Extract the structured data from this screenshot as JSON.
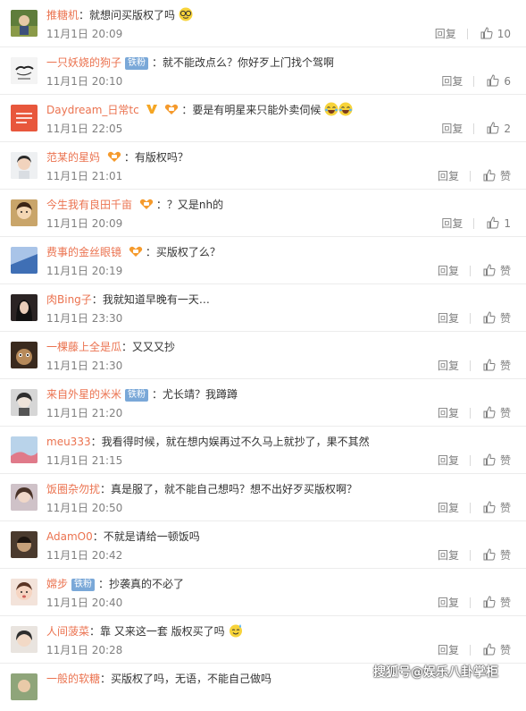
{
  "actions": {
    "reply_label": "回复",
    "like_label": "赞"
  },
  "colors": {
    "username": "#eb7350",
    "meta": "#808080",
    "badge_bg": "#7aa8d8"
  },
  "comments": [
    {
      "user": "推糖机",
      "text": "就想问买版权了吗",
      "emoji": "glasses-emoji",
      "time": "11月1日 20:09",
      "likes": "10",
      "badge": "",
      "fan": false,
      "verified": false
    },
    {
      "user": "一只妖娆的狗子",
      "text": "就不能改点么？你好歹上门找个驾啊",
      "time": "11月1日 20:10",
      "likes": "6",
      "badge": "铁粉",
      "fan": false,
      "verified": false
    },
    {
      "user": "Daydream_日常tc",
      "text": "要是有明星来只能外卖伺候",
      "emoji": "laugh-cry-emoji",
      "time": "11月1日 22:05",
      "likes": "2",
      "badge": "",
      "fan": true,
      "verified": false
    },
    {
      "user": "范某的星妈",
      "text": "有版权吗？",
      "time": "11月1日 21:01",
      "likes": "赞",
      "badge": "",
      "fan": true,
      "verified": false
    },
    {
      "user": "今生我有良田千亩",
      "text": "？又是nh的",
      "time": "11月1日 20:09",
      "likes": "1",
      "badge": "",
      "fan": true,
      "verified": false
    },
    {
      "user": "费事的金丝眼镜",
      "text": "买版权了么？",
      "time": "11月1日 20:19",
      "likes": "赞",
      "badge": "",
      "fan": true,
      "verified": false
    },
    {
      "user": "肉Bing子",
      "text": "我就知道早晚有一天…",
      "time": "11月1日 23:30",
      "likes": "赞",
      "badge": "",
      "fan": false,
      "verified": false
    },
    {
      "user": "一棵藤上全是瓜",
      "text": "又又又抄",
      "time": "11月1日 21:30",
      "likes": "赞",
      "badge": "",
      "fan": false,
      "verified": false
    },
    {
      "user": "来自外星的米米",
      "text": "尤长靖？我蹲蹲",
      "time": "11月1日 21:20",
      "likes": "赞",
      "badge": "铁粉",
      "fan": false,
      "verified": false
    },
    {
      "user": "meu333",
      "text": "我看得时候，就在想内娱再过不久马上就抄了，果不其然",
      "time": "11月1日 21:15",
      "likes": "赞",
      "badge": "",
      "fan": false,
      "verified": false
    },
    {
      "user": "饭圈杂勿扰",
      "text": "真是服了，就不能自己想吗？想不出好歹买版权啊？",
      "time": "11月1日 20:50",
      "likes": "赞",
      "badge": "",
      "fan": false,
      "verified": false
    },
    {
      "user": "AdamO0",
      "text": "不就是请给一顿饭吗",
      "time": "11月1日 20:42",
      "likes": "赞",
      "badge": "",
      "fan": false,
      "verified": false
    },
    {
      "user": "嫦步",
      "text": "抄袭真的不必了",
      "time": "11月1日 20:40",
      "likes": "赞",
      "badge": "铁粉",
      "fan": false,
      "verified": false
    },
    {
      "user": "人间菠菜",
      "text": "靠 又来这一套 版权买了吗",
      "emoji": "sweat-smile-emoji",
      "time": "11月1日 20:28",
      "likes": "赞",
      "badge": "",
      "fan": false,
      "verified": false
    },
    {
      "user": "一般的软糖",
      "text": "买版权了吗，无语，不能自己做吗",
      "time": "",
      "likes": "",
      "badge": "",
      "fan": false,
      "verified": false
    }
  ],
  "watermark": "搜狐号@娱乐八卦掌柜"
}
